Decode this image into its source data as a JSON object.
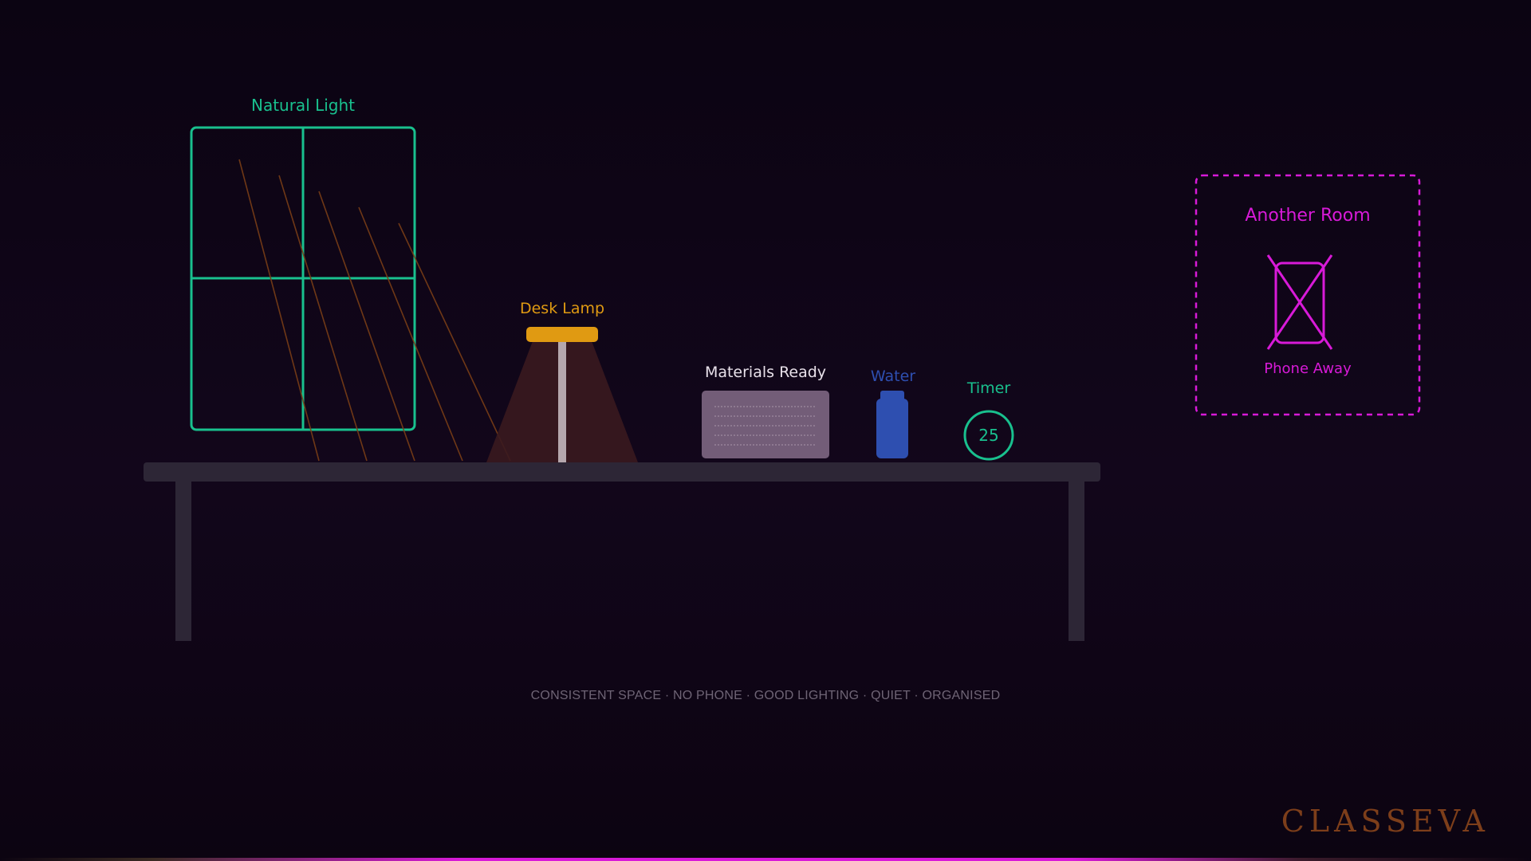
{
  "labels": {
    "natural_light": "Natural Light",
    "desk_lamp": "Desk Lamp",
    "materials_ready": "Materials Ready",
    "water": "Water",
    "timer": "Timer",
    "timer_value": "25",
    "another_room": "Another Room",
    "phone_away": "Phone Away"
  },
  "footer_caption": "CONSISTENT SPACE · NO PHONE · GOOD LIGHTING · QUIET · ORGANISED",
  "brand": "CLASSEVA",
  "colors": {
    "background": "#0e0516",
    "window": "#19c08e",
    "light_rays": "#7a3e16",
    "lamp": "#e09a12",
    "lamp_glow": "#3a1a1f",
    "lamp_pole": "#b5a7ad",
    "materials_box": "#735d78",
    "water": "#2e4fb0",
    "timer": "#19c08e",
    "phone_zone": "#d81ad8",
    "desk": "#2d2636",
    "caption": "#6e6475",
    "brand": "#7d3e1a",
    "label_white": "#e8e1ea"
  },
  "icons": {
    "window": "window-icon",
    "lamp": "desk-lamp-icon",
    "box": "materials-box-icon",
    "bottle": "water-bottle-icon",
    "timer": "timer-icon",
    "phone": "crossed-phone-icon"
  }
}
